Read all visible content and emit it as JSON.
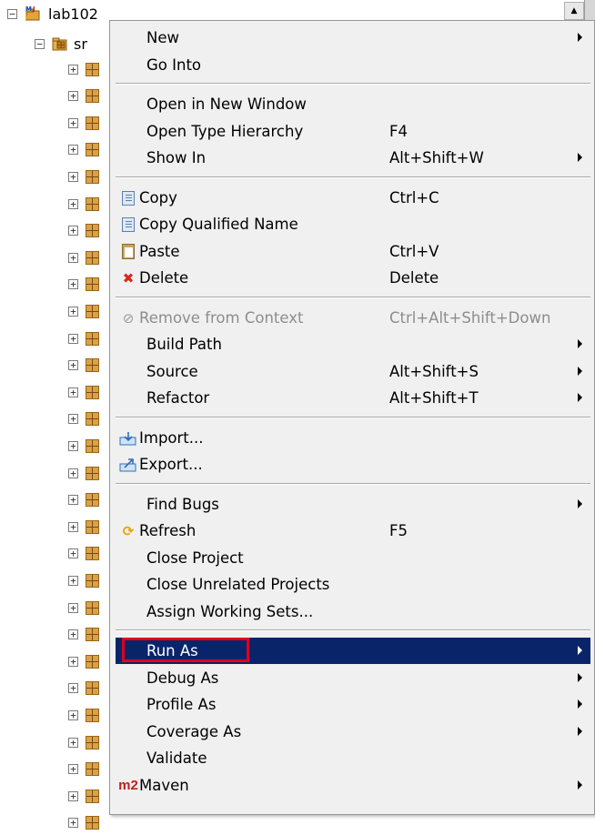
{
  "tree": {
    "project_label": "lab102",
    "src_label": "sr",
    "project_expander": "−",
    "src_expander": "−",
    "package_expander": "+",
    "package_rows": 29
  },
  "menu": {
    "items": [
      {
        "label": "New",
        "shortcut": "",
        "submenu": true,
        "icon": ""
      },
      {
        "label": "Go Into",
        "shortcut": "",
        "submenu": false,
        "icon": ""
      },
      {
        "separator": true
      },
      {
        "label": "Open in New Window",
        "shortcut": "",
        "submenu": false,
        "icon": ""
      },
      {
        "label": "Open Type Hierarchy",
        "shortcut": "F4",
        "submenu": false,
        "icon": ""
      },
      {
        "label": "Show In",
        "shortcut": "Alt+Shift+W",
        "submenu": true,
        "icon": ""
      },
      {
        "separator": true
      },
      {
        "label": "Copy",
        "shortcut": "Ctrl+C",
        "submenu": false,
        "icon": "copy-icon"
      },
      {
        "label": "Copy Qualified Name",
        "shortcut": "",
        "submenu": false,
        "icon": "copy-qualified-name-icon"
      },
      {
        "label": "Paste",
        "shortcut": "Ctrl+V",
        "submenu": false,
        "icon": "paste-icon"
      },
      {
        "label": "Delete",
        "shortcut": "Delete",
        "submenu": false,
        "icon": "delete-icon"
      },
      {
        "separator": true
      },
      {
        "label": "Remove from Context",
        "shortcut": "Ctrl+Alt+Shift+Down",
        "submenu": false,
        "icon": "remove-context-icon",
        "disabled": true
      },
      {
        "label": "Build Path",
        "shortcut": "",
        "submenu": true,
        "icon": ""
      },
      {
        "label": "Source",
        "shortcut": "Alt+Shift+S",
        "submenu": true,
        "icon": ""
      },
      {
        "label": "Refactor",
        "shortcut": "Alt+Shift+T",
        "submenu": true,
        "icon": ""
      },
      {
        "separator": true
      },
      {
        "label": "Import...",
        "shortcut": "",
        "submenu": false,
        "icon": "import-icon"
      },
      {
        "label": "Export...",
        "shortcut": "",
        "submenu": false,
        "icon": "export-icon"
      },
      {
        "separator": true
      },
      {
        "label": "Find Bugs",
        "shortcut": "",
        "submenu": true,
        "icon": ""
      },
      {
        "label": "Refresh",
        "shortcut": "F5",
        "submenu": false,
        "icon": "refresh-icon"
      },
      {
        "label": "Close Project",
        "shortcut": "",
        "submenu": false,
        "icon": ""
      },
      {
        "label": "Close Unrelated Projects",
        "shortcut": "",
        "submenu": false,
        "icon": ""
      },
      {
        "label": "Assign Working Sets...",
        "shortcut": "",
        "submenu": false,
        "icon": ""
      },
      {
        "separator": true
      },
      {
        "label": "Run As",
        "shortcut": "",
        "submenu": true,
        "icon": "",
        "selected": true
      },
      {
        "label": "Debug As",
        "shortcut": "",
        "submenu": true,
        "icon": ""
      },
      {
        "label": "Profile As",
        "shortcut": "",
        "submenu": true,
        "icon": ""
      },
      {
        "label": "Coverage As",
        "shortcut": "",
        "submenu": true,
        "icon": ""
      },
      {
        "label": "Validate",
        "shortcut": "",
        "submenu": false,
        "icon": ""
      },
      {
        "label": "Maven",
        "shortcut": "",
        "submenu": true,
        "icon": "maven-m2-icon"
      }
    ],
    "m2_text": "m2"
  },
  "colors": {
    "selection_bg": "#0a246a",
    "highlight_border": "#e0001c",
    "menu_bg": "#f0f0f0"
  }
}
